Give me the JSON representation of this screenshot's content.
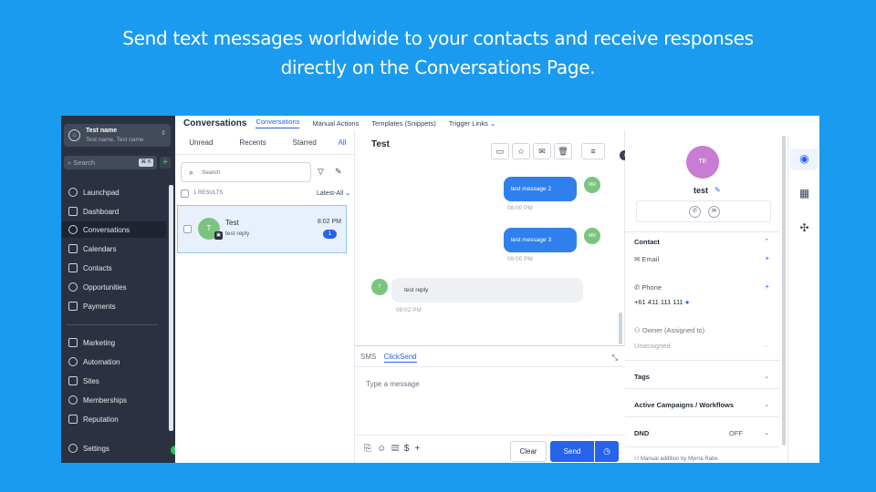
{
  "headline": {
    "line1": "Send text messages worldwide to your contacts and receive responses",
    "line2": "directly on the Conversations Page."
  },
  "sidebar": {
    "account_name": "Test name",
    "account_sub": "Test name, Test name",
    "search_label": "Search",
    "search_shortcut": "⌘ K",
    "items": [
      {
        "label": "Launchpad",
        "icon": "rocket-icon"
      },
      {
        "label": "Dashboard",
        "icon": "grid-icon"
      },
      {
        "label": "Conversations",
        "icon": "chat-icon"
      },
      {
        "label": "Calendars",
        "icon": "calendar-icon"
      },
      {
        "label": "Contacts",
        "icon": "contacts-icon"
      },
      {
        "label": "Opportunities",
        "icon": "opportunities-icon"
      },
      {
        "label": "Payments",
        "icon": "payments-icon"
      },
      {
        "label": "Marketing",
        "icon": "send-icon"
      },
      {
        "label": "Automation",
        "icon": "automation-icon"
      },
      {
        "label": "Sites",
        "icon": "sites-icon"
      },
      {
        "label": "Memberships",
        "icon": "memberships-icon"
      },
      {
        "label": "Reputation",
        "icon": "star-icon"
      },
      {
        "label": "Settings",
        "icon": "gear-icon"
      }
    ]
  },
  "topbar": {
    "title": "Conversations",
    "tabs": [
      "Conversations",
      "Manual Actions",
      "Templates (Snippets)",
      "Trigger Links ⌄"
    ]
  },
  "list": {
    "tabs": [
      "Unread",
      "Recents",
      "Starred",
      "All"
    ],
    "search_placeholder": "Search",
    "results": "1 RESULTS",
    "sort": "Latest-All",
    "item": {
      "initial": "T",
      "name": "Test",
      "preview": "test reply",
      "time": "8:02 PM",
      "badge": "1"
    }
  },
  "chat": {
    "name": "Test",
    "messages": [
      {
        "text": "test message 2",
        "time": "08:00 PM",
        "avatar": "MR"
      },
      {
        "text": "test message 3",
        "time": "08:00 PM",
        "avatar": "MR"
      },
      {
        "text": "test reply",
        "time": "08:02 PM",
        "avatar": "T"
      }
    ],
    "composer": {
      "tab_sms": "SMS",
      "tab_clicksend": "ClickSend",
      "placeholder": "Type a message",
      "clear": "Clear",
      "send": "Send"
    }
  },
  "contact": {
    "initials": "TE",
    "name": "test",
    "section_contact": "Contact",
    "email_label": "Email",
    "phone_label": "Phone",
    "phone_value": "+61 411 111 111",
    "owner_label": "Owner (Assigned to)",
    "owner_value": "Unassigned",
    "tags": "Tags",
    "campaigns": "Active Campaigns / Workflows",
    "dnd": "DND",
    "dnd_value": "OFF",
    "footer": "Manual addition by Myrna Rabe"
  },
  "colors": {
    "page_bg": "#1a9bf0",
    "sidebar_bg": "#2b3140",
    "accent": "#2563eb",
    "bubble_out": "#2f80ed",
    "contact_avatar": "#c77dd1",
    "user_avatar": "#7bc47f"
  }
}
